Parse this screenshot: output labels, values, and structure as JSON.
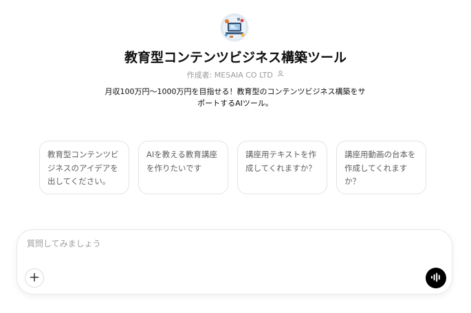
{
  "gpt": {
    "title": "教育型コンテンツビジネス構築ツール",
    "author": "作成者: MESAIA CO LTD",
    "description": "月収100万円〜1000万円を目指せる！教育型のコンテンツビジネス構築をサポートするAIツール。",
    "avatar_icon": "gpt-avatar-icon",
    "author_icon": "person-icon"
  },
  "starters": [
    "教育型コンテンツビジネスのアイデアを出してください。",
    "AIを教える教育講座を作りたいです",
    "講座用テキストを作成してくれますか？",
    "講座用動画の台本を作成してくれますか？"
  ],
  "composer": {
    "placeholder": "質問してみましょう",
    "value": "",
    "add_icon": "plus-icon",
    "voice_icon": "voice-waveform-icon"
  },
  "colors": {
    "text": "#0d0d0d",
    "muted": "#9b9b9b",
    "border": "#e3e3e3",
    "voice_button": "#000000"
  }
}
